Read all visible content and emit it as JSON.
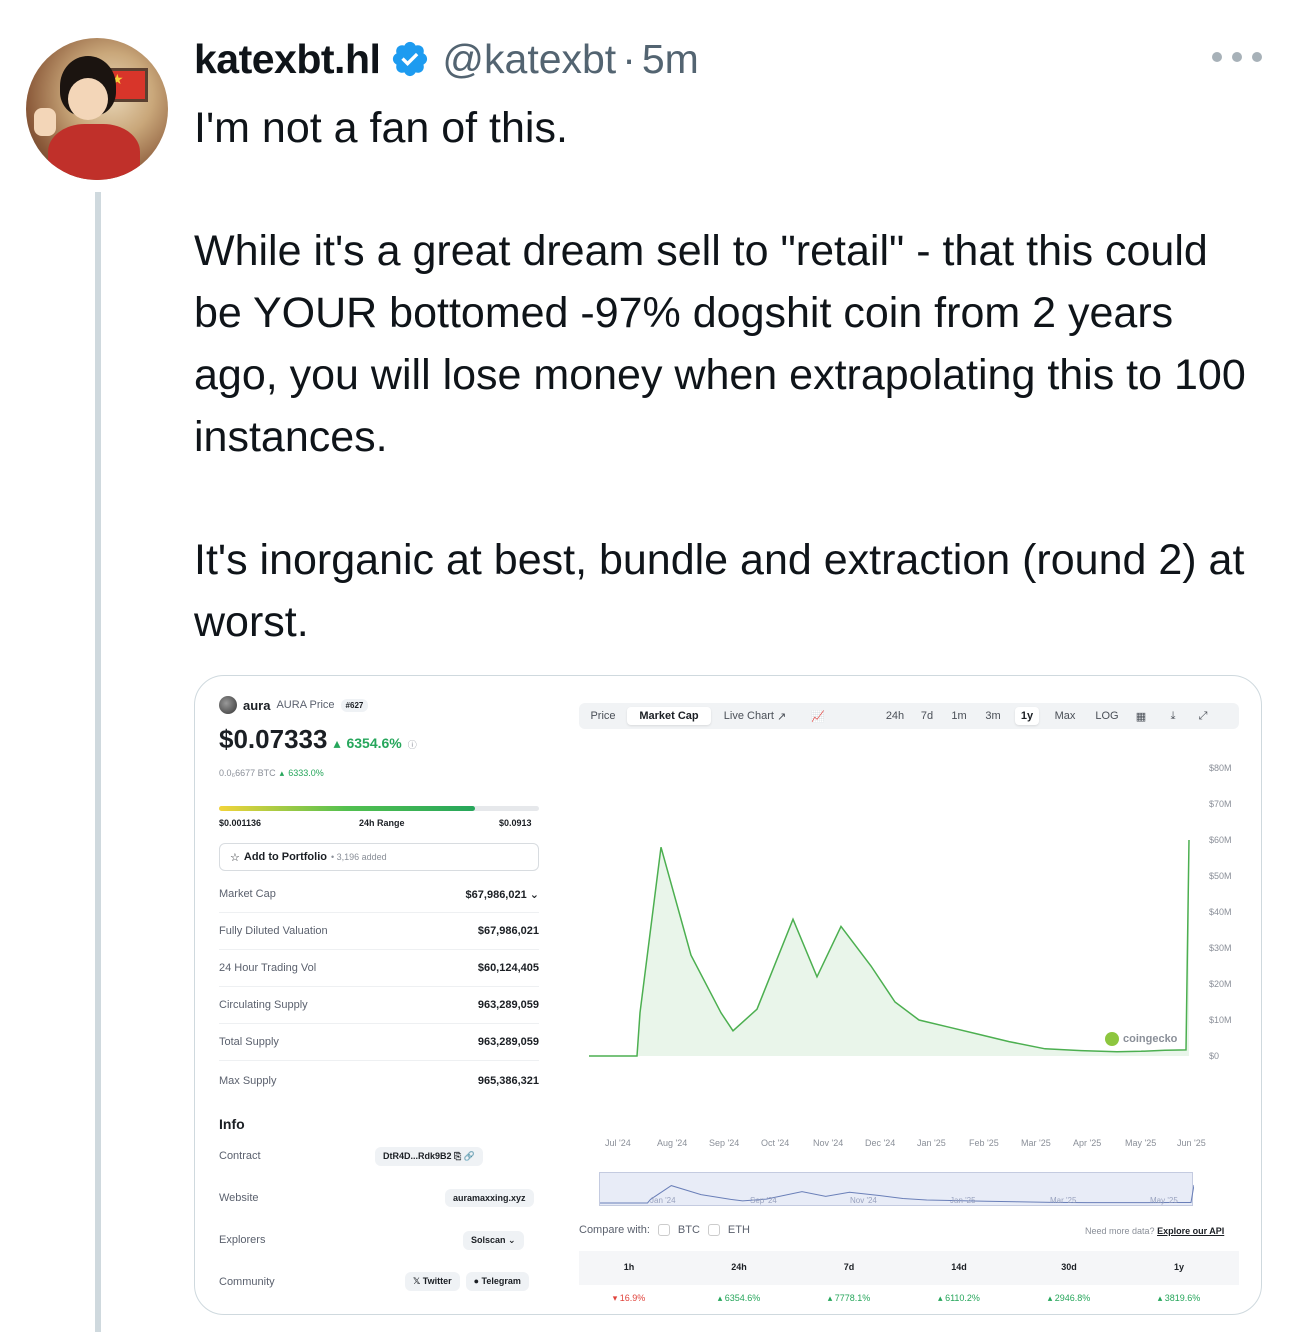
{
  "tweet": {
    "display_name": "katexbt.hl",
    "handle": "@katexbt",
    "separator": "·",
    "time": "5m",
    "paragraphs": [
      "I'm not a fan of this.",
      "While it's a great dream sell to \"retail\" - that this could be YOUR bottomed -97% dogshit coin from 2 years ago, you will lose money when extrapolating this to 100 instances.",
      "It's inorganic at best, bundle and extraction (round 2) at worst."
    ],
    "colors": {
      "verified": "#1d9bf0",
      "secondary_text": "#536471"
    },
    "icons": {
      "verified": "verified-badge-icon",
      "more": "more-icon"
    }
  },
  "screenshot": {
    "coin": {
      "name": "aura",
      "ticker_label": "AURA Price",
      "rank": "#627",
      "price": "$0.07333",
      "change_24h": "6354.6%",
      "btc_price": "0.0₆6677 BTC",
      "btc_change": "6333.0%",
      "range_low": "$0.001136",
      "range_label": "24h Range",
      "range_high": "$0.0913",
      "range_position": 0.8,
      "portfolio_label": "Add to Portfolio",
      "portfolio_count": "• 3,196 added"
    },
    "stats": [
      {
        "label": "Market Cap",
        "value": "$67,986,021"
      },
      {
        "label": "Fully Diluted Valuation",
        "value": "$67,986,021"
      },
      {
        "label": "24 Hour Trading Vol",
        "value": "$60,124,405"
      },
      {
        "label": "Circulating Supply",
        "value": "963,289,059"
      },
      {
        "label": "Total Supply",
        "value": "963,289,059"
      },
      {
        "label": "Max Supply",
        "value": "965,386,321"
      }
    ],
    "info": {
      "title": "Info",
      "contract_label": "Contract",
      "contract_value": "DtR4D...Rdk9B2",
      "website_label": "Website",
      "website_value": "auramaxxing.xyz",
      "explorers_label": "Explorers",
      "explorers_value": "Solscan",
      "community_label": "Community",
      "community_twitter": "Twitter",
      "community_telegram": "Telegram"
    },
    "chart_tabs": {
      "left": [
        "Price",
        "Market Cap",
        "Live Chart"
      ],
      "active": "Market Cap",
      "ranges": [
        "24h",
        "7d",
        "1m",
        "3m",
        "1y",
        "Max",
        "LOG"
      ],
      "active_range": "1y"
    },
    "watermark": "coingecko",
    "compare": {
      "label": "Compare with:",
      "options": [
        "BTC",
        "ETH"
      ]
    },
    "api_note": "Need more data?",
    "api_link": "Explore our API",
    "performance": [
      {
        "period": "1h",
        "value": "16.9%",
        "dir": "down"
      },
      {
        "period": "24h",
        "value": "6354.6%",
        "dir": "up"
      },
      {
        "period": "7d",
        "value": "7778.1%",
        "dir": "up"
      },
      {
        "period": "14d",
        "value": "6110.2%",
        "dir": "up"
      },
      {
        "period": "30d",
        "value": "2946.8%",
        "dir": "up"
      },
      {
        "period": "1y",
        "value": "3819.6%",
        "dir": "up"
      }
    ]
  },
  "chart_data": {
    "type": "area",
    "title": "",
    "xlabel": "",
    "ylabel": "",
    "x": [
      "Jul '24",
      "Aug '24",
      "Sep '24",
      "Oct '24",
      "Nov '24",
      "Dec '24",
      "Jan '25",
      "Feb '25",
      "Mar '25",
      "Apr '25",
      "May '25",
      "Jun '25"
    ],
    "y_ticks": [
      "$0",
      "$10M",
      "$20M",
      "$30M",
      "$40M",
      "$50M",
      "$60M",
      "$70M",
      "$80M"
    ],
    "ylim": [
      0,
      80000000
    ],
    "series": [
      {
        "values": [
          0,
          0,
          12000000,
          58000000,
          28000000,
          12000000,
          7000000,
          13000000,
          38000000,
          22000000,
          36000000,
          25000000,
          15000000,
          10000000,
          8000000,
          6000000,
          4000000,
          2000000,
          1500000,
          1200000,
          1300000,
          1600000,
          1700000,
          60000000
        ],
        "x_fraction": [
          0.0,
          0.08,
          0.085,
          0.12,
          0.17,
          0.22,
          0.24,
          0.28,
          0.34,
          0.38,
          0.42,
          0.47,
          0.51,
          0.55,
          0.6,
          0.65,
          0.7,
          0.76,
          0.82,
          0.88,
          0.92,
          0.96,
          0.995,
          1.0
        ]
      }
    ],
    "x_navigator": [
      "Jan '24",
      "Sep '24",
      "Nov '24",
      "Jan '25",
      "Mar '25",
      "May '25"
    ],
    "grid": false,
    "color": "#4caf50"
  }
}
